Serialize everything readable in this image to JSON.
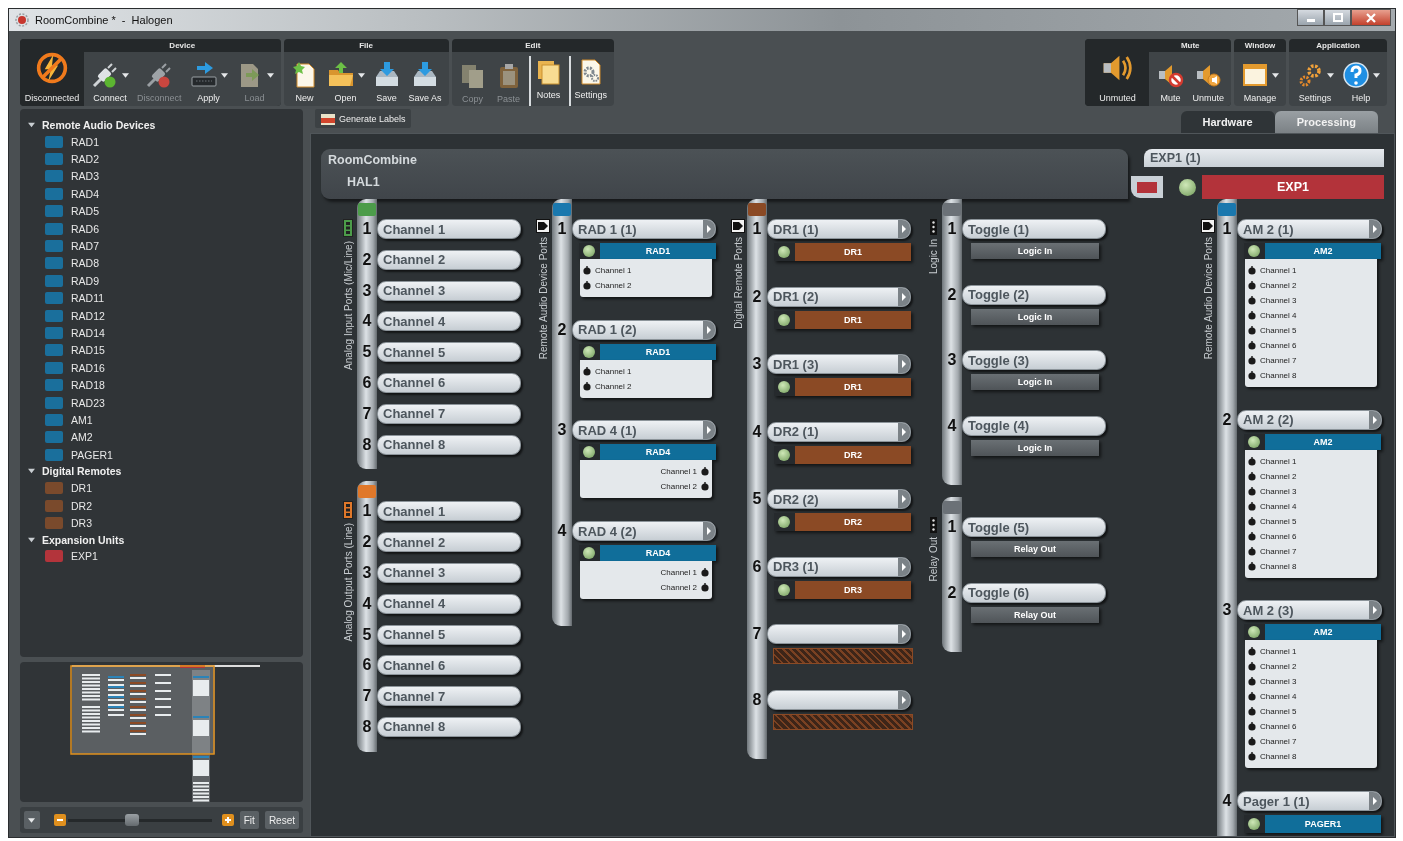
{
  "window": {
    "title": "RoomCombine *  -  Halogen"
  },
  "ribbon": {
    "left": [
      {
        "title": "Device",
        "status": {
          "label": "Disconnected"
        },
        "buttons": [
          {
            "label": "Connect",
            "disabled": false,
            "menu": true,
            "divider_before": false
          },
          {
            "label": "Disconnect",
            "disabled": true,
            "menu": false,
            "divider_before": false
          },
          {
            "label": "Apply",
            "disabled": false,
            "menu": true,
            "divider_before": false
          },
          {
            "label": "Load",
            "disabled": true,
            "menu": true,
            "divider_before": false
          }
        ]
      },
      {
        "title": "File",
        "buttons": [
          {
            "label": "New",
            "disabled": false,
            "menu": false,
            "divider_before": false
          },
          {
            "label": "Open",
            "disabled": false,
            "menu": true,
            "divider_before": false
          },
          {
            "label": "Save",
            "disabled": false,
            "menu": false,
            "divider_before": false
          },
          {
            "label": "Save As",
            "disabled": false,
            "menu": false,
            "divider_before": false
          }
        ]
      },
      {
        "title": "Edit",
        "buttons": [
          {
            "label": "Copy",
            "disabled": true,
            "menu": false,
            "divider_before": false
          },
          {
            "label": "Paste",
            "disabled": true,
            "menu": false,
            "divider_before": false
          },
          {
            "label": "Notes",
            "disabled": false,
            "menu": false,
            "divider_before": true
          },
          {
            "label": "Settings",
            "disabled": false,
            "menu": false,
            "divider_before": true
          }
        ]
      }
    ],
    "right": [
      {
        "title": "Mute",
        "status": {
          "label": "Unmuted"
        },
        "buttons": [
          {
            "label": "Mute",
            "disabled": false,
            "menu": false,
            "divider_before": false
          },
          {
            "label": "Unmute",
            "disabled": false,
            "menu": false,
            "divider_before": false
          }
        ]
      },
      {
        "title": "Window",
        "buttons": [
          {
            "label": "Manage",
            "disabled": false,
            "menu": true,
            "divider_before": false
          }
        ]
      },
      {
        "title": "Application",
        "buttons": [
          {
            "label": "Settings",
            "disabled": false,
            "menu": true,
            "divider_before": false
          },
          {
            "label": "Help",
            "disabled": false,
            "menu": true,
            "divider_before": false
          }
        ]
      }
    ]
  },
  "sidebar": {
    "tree": [
      {
        "label": "Remote Audio Devices",
        "expanded": true,
        "children": [
          {
            "label": "RAD1",
            "color": "#1a6f9c"
          },
          {
            "label": "RAD2",
            "color": "#1a6f9c"
          },
          {
            "label": "RAD3",
            "color": "#1a6f9c"
          },
          {
            "label": "RAD4",
            "color": "#1a6f9c"
          },
          {
            "label": "RAD5",
            "color": "#1a6f9c"
          },
          {
            "label": "RAD6",
            "color": "#1a6f9c"
          },
          {
            "label": "RAD7",
            "color": "#1a6f9c"
          },
          {
            "label": "RAD8",
            "color": "#1a6f9c"
          },
          {
            "label": "RAD9",
            "color": "#1a6f9c"
          },
          {
            "label": "RAD11",
            "color": "#1a6f9c"
          },
          {
            "label": "RAD12",
            "color": "#1a6f9c"
          },
          {
            "label": "RAD14",
            "color": "#1a6f9c"
          },
          {
            "label": "RAD15",
            "color": "#1a6f9c"
          },
          {
            "label": "RAD16",
            "color": "#1a6f9c"
          },
          {
            "label": "RAD18",
            "color": "#1a6f9c"
          },
          {
            "label": "RAD23",
            "color": "#1a6f9c"
          },
          {
            "label": "AM1",
            "color": "#1a6f9c"
          },
          {
            "label": "AM2",
            "color": "#1a6f9c"
          },
          {
            "label": "PAGER1",
            "color": "#1a6f9c"
          }
        ]
      },
      {
        "label": "Digital Remotes",
        "expanded": true,
        "children": [
          {
            "label": "DR1",
            "color": "#7a4a2c"
          },
          {
            "label": "DR2",
            "color": "#7a4a2c"
          },
          {
            "label": "DR3",
            "color": "#7a4a2c"
          }
        ]
      },
      {
        "label": "Expansion Units",
        "expanded": true,
        "children": [
          {
            "label": "EXP1",
            "color": "#b3343b"
          }
        ]
      }
    ],
    "zoom": {
      "level": 0.45
    },
    "buttons": [
      "Fit",
      "Reset"
    ]
  },
  "canvas_toolbar": {
    "button": "Generate Labels"
  },
  "tabs": [
    {
      "label": "Hardware",
      "selected": true
    },
    {
      "label": "Processing",
      "selected": false
    }
  ],
  "canvas": {
    "hal": {
      "title": "RoomCombine",
      "name": "HAL1",
      "columns": [
        [
          {
            "label": "Analog Input Ports (Mic/Line)",
            "color": "#4c9c4a",
            "kind": "phoenix",
            "ports": [
              {
                "number": "1",
                "kind": "channel",
                "name": "Channel 1"
              },
              {
                "number": "2",
                "kind": "channel",
                "name": "Channel 2"
              },
              {
                "number": "3",
                "kind": "channel",
                "name": "Channel 3"
              },
              {
                "number": "4",
                "kind": "channel",
                "name": "Channel 4"
              },
              {
                "number": "5",
                "kind": "channel",
                "name": "Channel 5"
              },
              {
                "number": "6",
                "kind": "channel",
                "name": "Channel 6"
              },
              {
                "number": "7",
                "kind": "channel",
                "name": "Channel 7"
              },
              {
                "number": "8",
                "kind": "channel",
                "name": "Channel 8"
              }
            ]
          },
          {
            "label": "Analog Output Ports (Line)",
            "color": "#e0782a",
            "kind": "phoenix",
            "ports": [
              {
                "number": "1",
                "kind": "channel",
                "name": "Channel 1"
              },
              {
                "number": "2",
                "kind": "channel",
                "name": "Channel 2"
              },
              {
                "number": "3",
                "kind": "channel",
                "name": "Channel 3"
              },
              {
                "number": "4",
                "kind": "channel",
                "name": "Channel 4"
              },
              {
                "number": "5",
                "kind": "channel",
                "name": "Channel 5"
              },
              {
                "number": "6",
                "kind": "channel",
                "name": "Channel 6"
              },
              {
                "number": "7",
                "kind": "channel",
                "name": "Channel 7"
              },
              {
                "number": "8",
                "kind": "channel",
                "name": "Channel 8"
              }
            ]
          }
        ],
        [
          {
            "label": "Remote Audio Device Ports",
            "color": "#1a78ae",
            "kind": "rj45",
            "ports": [
              {
                "number": "1",
                "kind": "device",
                "name": "RAD 1 (1)",
                "device": {
                  "name": "RAD1",
                  "color": "#106e9a",
                  "online": true,
                  "icons_right": false,
                  "channels": [
                    "Channel 1",
                    "Channel 2"
                  ]
                }
              },
              {
                "number": "2",
                "kind": "device",
                "name": "RAD 1 (2)",
                "device": {
                  "name": "RAD1",
                  "color": "#106e9a",
                  "online": true,
                  "icons_right": false,
                  "channels": [
                    "Channel 1",
                    "Channel 2"
                  ]
                }
              },
              {
                "number": "3",
                "kind": "device",
                "name": "RAD 4 (1)",
                "device": {
                  "name": "RAD4",
                  "color": "#106e9a",
                  "online": true,
                  "icons_right": true,
                  "channels": [
                    "Channel 1",
                    "Channel 2"
                  ]
                }
              },
              {
                "number": "4",
                "kind": "device",
                "name": "RAD 4 (2)",
                "device": {
                  "name": "RAD4",
                  "color": "#106e9a",
                  "online": true,
                  "icons_right": true,
                  "channels": [
                    "Channel 1",
                    "Channel 2"
                  ]
                }
              }
            ]
          }
        ],
        [
          {
            "label": "Digital Remote Ports",
            "color": "#8b4a25",
            "kind": "rj45",
            "ports": [
              {
                "number": "1",
                "kind": "device",
                "name": "DR1 (1)",
                "device": {
                  "name": "DR1",
                  "color": "#8b4a25",
                  "online": true
                }
              },
              {
                "number": "2",
                "kind": "device",
                "name": "DR1 (2)",
                "device": {
                  "name": "DR1",
                  "color": "#8b4a25",
                  "online": true
                }
              },
              {
                "number": "3",
                "kind": "device",
                "name": "DR1 (3)",
                "device": {
                  "name": "DR1",
                  "color": "#8b4a25",
                  "online": true
                }
              },
              {
                "number": "4",
                "kind": "device",
                "name": "DR2 (1)",
                "device": {
                  "name": "DR2",
                  "color": "#8b4a25",
                  "online": true
                }
              },
              {
                "number": "5",
                "kind": "device",
                "name": "DR2 (2)",
                "device": {
                  "name": "DR2",
                  "color": "#8b4a25",
                  "online": true
                }
              },
              {
                "number": "6",
                "kind": "device",
                "name": "DR3 (1)",
                "device": {
                  "name": "DR3",
                  "color": "#8b4a25",
                  "online": true
                }
              },
              {
                "number": "7",
                "kind": "empty"
              },
              {
                "number": "8",
                "kind": "empty"
              }
            ]
          }
        ],
        [
          {
            "label": "Logic In",
            "color": "#6b7177",
            "kind": "terminal",
            "ports": [
              {
                "number": "1",
                "kind": "logic",
                "name": "Toggle (1)",
                "function": "Logic In"
              },
              {
                "number": "2",
                "kind": "logic",
                "name": "Toggle (2)",
                "function": "Logic In"
              },
              {
                "number": "3",
                "kind": "logic",
                "name": "Toggle (3)",
                "function": "Logic In"
              },
              {
                "number": "4",
                "kind": "logic",
                "name": "Toggle (4)",
                "function": "Logic In"
              }
            ]
          },
          {
            "label": "Relay Out",
            "color": "#6b7177",
            "kind": "terminal",
            "ports": [
              {
                "number": "1",
                "kind": "logic",
                "name": "Toggle (5)",
                "function": "Relay Out"
              },
              {
                "number": "2",
                "kind": "logic",
                "name": "Toggle (6)",
                "function": "Relay Out"
              }
            ]
          }
        ]
      ]
    },
    "expansion": {
      "port": "EXP1 (1)",
      "name": "EXP1",
      "color": "#b3333a",
      "online": true,
      "group": {
        "label": "Remote Audio Device Ports",
        "color": "#1a78ae",
        "kind": "rj45",
        "ports": [
          {
            "number": "1",
            "kind": "device",
            "name": "AM 2 (1)",
            "device": {
              "name": "AM2",
              "color": "#106e9a",
              "online": true,
              "icons_right": false,
              "channels": [
                "Channel 1",
                "Channel 2",
                "Channel 3",
                "Channel 4",
                "Channel 5",
                "Channel 6",
                "Channel 7",
                "Channel 8"
              ]
            }
          },
          {
            "number": "2",
            "kind": "device",
            "name": "AM 2 (2)",
            "device": {
              "name": "AM2",
              "color": "#106e9a",
              "online": true,
              "icons_right": false,
              "channels": [
                "Channel 1",
                "Channel 2",
                "Channel 3",
                "Channel 4",
                "Channel 5",
                "Channel 6",
                "Channel 7",
                "Channel 8"
              ]
            }
          },
          {
            "number": "3",
            "kind": "device",
            "name": "AM 2 (3)",
            "device": {
              "name": "AM2",
              "color": "#106e9a",
              "online": true,
              "icons_right": false,
              "channels": [
                "Channel 1",
                "Channel 2",
                "Channel 3",
                "Channel 4",
                "Channel 5",
                "Channel 6",
                "Channel 7",
                "Channel 8"
              ]
            }
          },
          {
            "number": "4",
            "kind": "device",
            "name": "Pager 1 (1)",
            "device": {
              "name": "PAGER1",
              "color": "#106e9a",
              "online": true
            }
          }
        ]
      }
    }
  }
}
